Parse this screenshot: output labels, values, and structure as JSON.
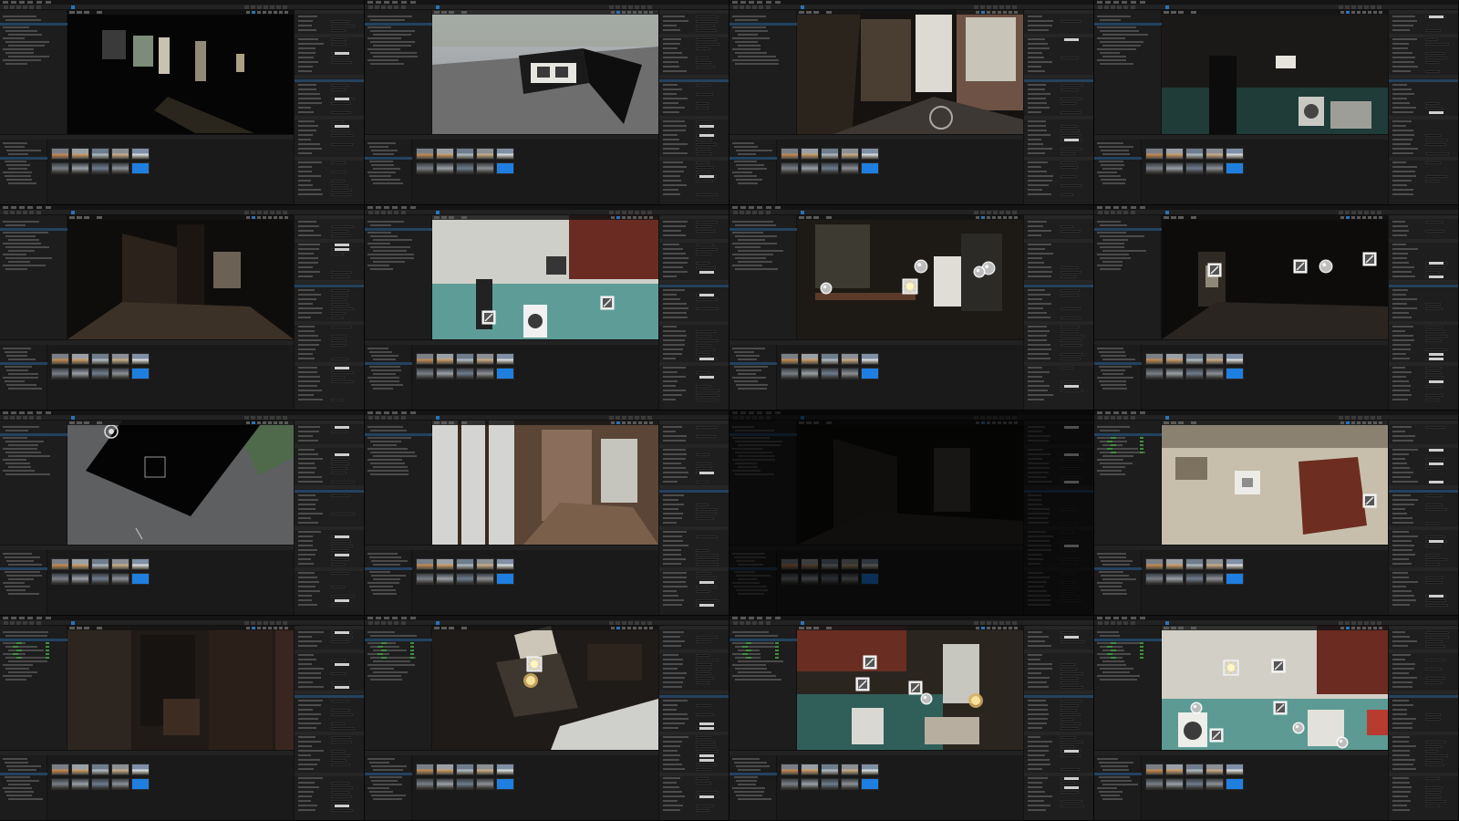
{
  "sheet": {
    "title": "",
    "tiles": [
      {
        "id": "t1",
        "scene": "dark-room-window-light",
        "dim": false
      },
      {
        "id": "t2",
        "scene": "house-block-exterior",
        "dim": false
      },
      {
        "id": "t3",
        "scene": "balcony-sunlit-corridor",
        "dim": false
      },
      {
        "id": "t4",
        "scene": "kitchen-dim-green-wall",
        "dim": false
      },
      {
        "id": "t5",
        "scene": "dark-hallway",
        "dim": false
      },
      {
        "id": "t6",
        "scene": "kitchen-teal-wall-with-light-icons",
        "dim": false
      },
      {
        "id": "t7",
        "scene": "messy-room-with-lights",
        "dim": false
      },
      {
        "id": "t8",
        "scene": "dark-hall-with-light-icons",
        "dim": false
      },
      {
        "id": "t9",
        "scene": "top-view-black-block",
        "dim": false
      },
      {
        "id": "t10",
        "scene": "sunroom-windows",
        "dim": false
      },
      {
        "id": "t11",
        "scene": "dimmed-hallway-screen",
        "dim": true
      },
      {
        "id": "t12",
        "scene": "kitchen-corner-window-light",
        "dim": false
      },
      {
        "id": "t13",
        "scene": "dark-bedroom",
        "dim": false
      },
      {
        "id": "t14",
        "scene": "top-down-cluttered-room",
        "dim": false
      },
      {
        "id": "t15",
        "scene": "kitchen-green-wall-with-icons",
        "dim": false
      },
      {
        "id": "t16",
        "scene": "kitchen-teal-wall-many-icons",
        "dim": false
      }
    ]
  },
  "colors": {
    "editor_bg": "#1b1b1b",
    "panel_bg": "#1e1e1e",
    "accent_blue": "#1f7fe0",
    "selection": "#24425f",
    "outliner_green": "#3f8f3f"
  },
  "icons": {
    "light": "light-source-icon",
    "sun": "directional-light-icon",
    "rect_light": "rect-light-icon",
    "reflection": "reflection-capture-icon"
  }
}
